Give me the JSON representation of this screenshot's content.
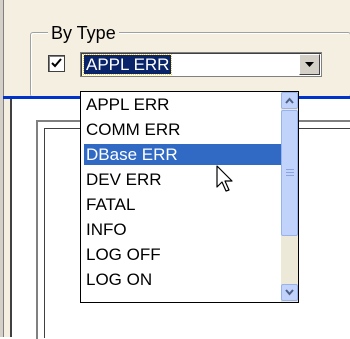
{
  "group": {
    "title": "By Type"
  },
  "checkbox": {
    "checked": true
  },
  "combo": {
    "value": "APPL ERR"
  },
  "dropdown": {
    "items": [
      "APPL ERR",
      "COMM ERR",
      "DBase ERR",
      "DEV ERR",
      "FATAL",
      "INFO",
      "LOG OFF",
      "LOG ON"
    ],
    "selected_item": "DBase ERR"
  },
  "colors": {
    "selection": "#316ac5",
    "combo_selection": "#0a246a",
    "panel": "#f4efe1",
    "accent_bar": "#0033cc"
  },
  "icons": [
    "check-icon",
    "chevron-down-icon",
    "scroll-up-icon",
    "scroll-down-icon",
    "pointer-cursor-icon"
  ]
}
